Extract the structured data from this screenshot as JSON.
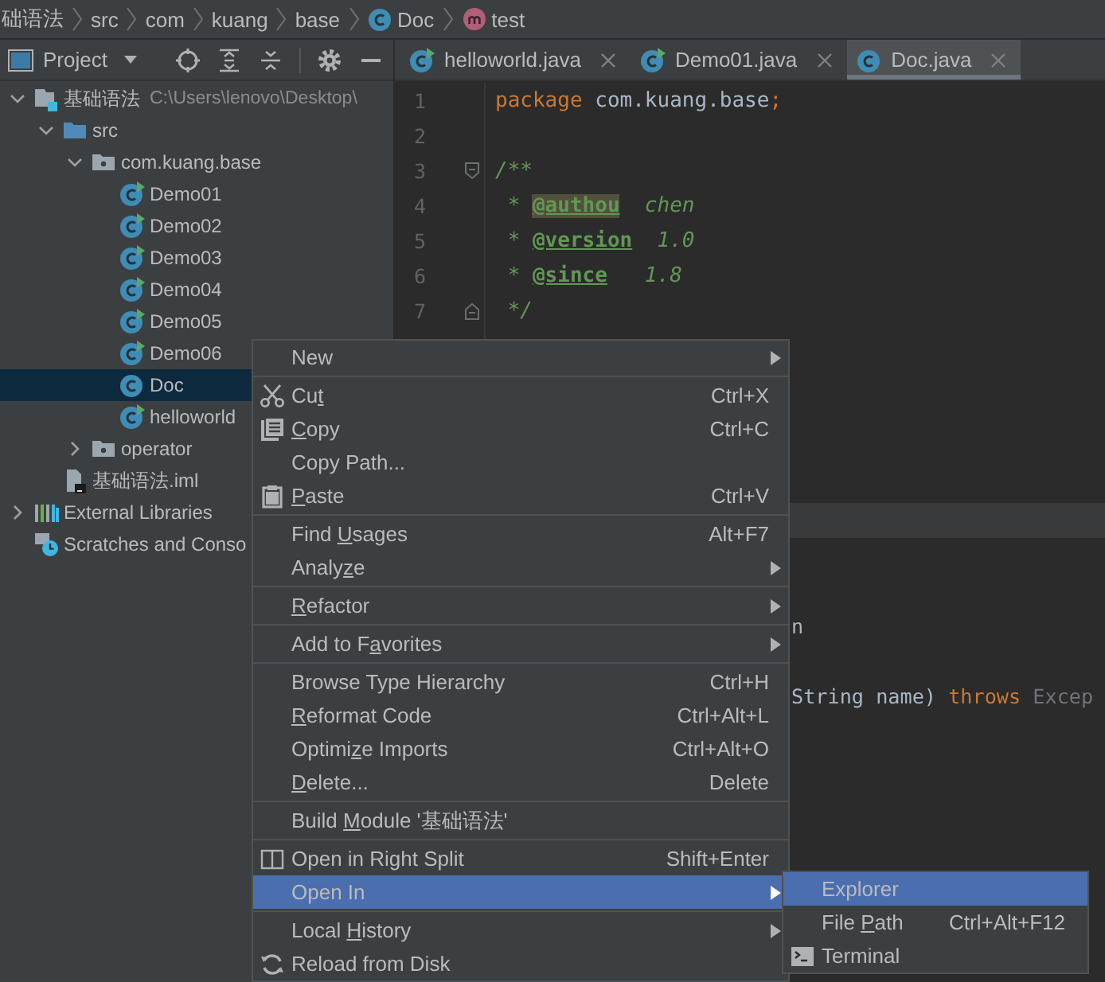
{
  "breadcrumbs": [
    {
      "label": "础语法",
      "kind": "text"
    },
    {
      "label": "src",
      "kind": "text"
    },
    {
      "label": "com",
      "kind": "text"
    },
    {
      "label": "kuang",
      "kind": "text"
    },
    {
      "label": "base",
      "kind": "text"
    },
    {
      "label": "Doc",
      "kind": "class"
    },
    {
      "label": "test",
      "kind": "method"
    }
  ],
  "project_panel": {
    "title": "Project"
  },
  "tree": [
    {
      "label": "基础语法",
      "path": "C:\\Users\\lenovo\\Desktop\\",
      "kind": "module",
      "expanded": true,
      "selected": false,
      "children": [
        {
          "label": "src",
          "kind": "folder",
          "expanded": true,
          "selected": false,
          "children": [
            {
              "label": "com.kuang.base",
              "kind": "package",
              "expanded": true,
              "selected": false,
              "children": [
                {
                  "label": "Demo01",
                  "kind": "class",
                  "runnable": true,
                  "selected": false
                },
                {
                  "label": "Demo02",
                  "kind": "class",
                  "runnable": true,
                  "selected": false
                },
                {
                  "label": "Demo03",
                  "kind": "class",
                  "runnable": true,
                  "selected": false
                },
                {
                  "label": "Demo04",
                  "kind": "class",
                  "runnable": true,
                  "selected": false
                },
                {
                  "label": "Demo05",
                  "kind": "class",
                  "runnable": true,
                  "selected": false
                },
                {
                  "label": "Demo06",
                  "kind": "class",
                  "runnable": true,
                  "selected": false
                },
                {
                  "label": "Doc",
                  "kind": "class",
                  "runnable": false,
                  "selected": true
                },
                {
                  "label": "helloworld",
                  "kind": "class",
                  "runnable": true,
                  "selected": false
                }
              ]
            },
            {
              "label": "operator",
              "kind": "package",
              "expanded": false,
              "selected": false
            }
          ]
        },
        {
          "label": "基础语法.iml",
          "kind": "iml",
          "selected": false
        }
      ]
    },
    {
      "label": "External Libraries",
      "kind": "libraries",
      "expanded": false,
      "selected": false
    },
    {
      "label": "Scratches and Conso",
      "kind": "scratches",
      "selected": false
    }
  ],
  "tabs": [
    {
      "label": "helloworld.java",
      "kind": "class",
      "runnable": true,
      "selected": false
    },
    {
      "label": "Demo01.java",
      "kind": "class",
      "runnable": true,
      "selected": false
    },
    {
      "label": "Doc.java",
      "kind": "class",
      "runnable": false,
      "selected": true
    }
  ],
  "editor": {
    "lines": [
      {
        "kind": "code",
        "number": "1",
        "current": false,
        "segments": [
          {
            "kind": "keyword",
            "text": "package "
          },
          {
            "kind": "plain",
            "text": "com.kuang.base"
          },
          {
            "kind": "keyword",
            "text": ";"
          }
        ]
      },
      {
        "kind": "code",
        "number": "2",
        "current": false
      },
      {
        "kind": "fold_start",
        "number": "3",
        "current": false,
        "segments": [
          {
            "kind": "comment",
            "text": "/**"
          }
        ]
      },
      {
        "kind": "code",
        "number": "4",
        "current": false,
        "segments": [
          {
            "kind": "comment",
            "text": " * "
          },
          {
            "kind": "doctag",
            "text": "@authou",
            "highlighted": true
          },
          {
            "kind": "comment",
            "text": "  chen"
          }
        ]
      },
      {
        "kind": "code",
        "number": "5",
        "current": false,
        "segments": [
          {
            "kind": "comment",
            "text": " * "
          },
          {
            "kind": "doctag",
            "text": "@version",
            "highlighted": false
          },
          {
            "kind": "comment",
            "text": "  1.0"
          }
        ]
      },
      {
        "kind": "code",
        "number": "6",
        "current": false,
        "segments": [
          {
            "kind": "comment",
            "text": " * "
          },
          {
            "kind": "doctag",
            "text": "@since",
            "highlighted": false
          },
          {
            "kind": "comment",
            "text": "   1.8"
          }
        ]
      },
      {
        "kind": "fold_end",
        "number": "7",
        "current": false,
        "segments": [
          {
            "kind": "comment",
            "text": " */"
          }
        ]
      },
      {
        "kind": "code",
        "current": false
      },
      {
        "kind": "code",
        "current": false
      },
      {
        "kind": "code",
        "current": false
      },
      {
        "kind": "code",
        "current": false
      },
      {
        "kind": "code",
        "current": false
      },
      {
        "kind": "code",
        "current": true
      },
      {
        "kind": "code",
        "current": false
      },
      {
        "kind": "code",
        "current": false
      },
      {
        "kind": "fragment",
        "current": false,
        "segments": [
          {
            "kind": "plain",
            "text": "n"
          }
        ]
      },
      {
        "kind": "code",
        "current": false
      },
      {
        "kind": "fragment",
        "current": false,
        "segments": [
          {
            "kind": "plain",
            "text": "String name) "
          },
          {
            "kind": "keyword",
            "text": "throws"
          },
          {
            "kind": "unused",
            "text": " Excep"
          }
        ]
      }
    ]
  },
  "menu": {
    "items": [
      {
        "kind": "item",
        "label": [
          {
            "text": "New",
            "underlined": false
          }
        ],
        "has_submenu": true,
        "selected": false
      },
      {
        "kind": "separator"
      },
      {
        "kind": "cut",
        "label": [
          {
            "text": "Cu",
            "underlined": false
          },
          {
            "text": "t",
            "underlined": true
          }
        ],
        "shortcut": "Ctrl+X",
        "has_submenu": false,
        "selected": false
      },
      {
        "kind": "copy",
        "label": [
          {
            "text": "C",
            "underlined": true
          },
          {
            "text": "opy",
            "underlined": false
          }
        ],
        "shortcut": "Ctrl+C",
        "has_submenu": false,
        "selected": false
      },
      {
        "kind": "item",
        "label": [
          {
            "text": "Copy Path...",
            "underlined": false
          }
        ],
        "has_submenu": false,
        "selected": false
      },
      {
        "kind": "paste",
        "label": [
          {
            "text": "P",
            "underlined": true
          },
          {
            "text": "aste",
            "underlined": false
          }
        ],
        "shortcut": "Ctrl+V",
        "has_submenu": false,
        "selected": false
      },
      {
        "kind": "separator"
      },
      {
        "kind": "item",
        "label": [
          {
            "text": "Find ",
            "underlined": false
          },
          {
            "text": "U",
            "underlined": true
          },
          {
            "text": "sages",
            "underlined": false
          }
        ],
        "shortcut": "Alt+F7",
        "has_submenu": false,
        "selected": false
      },
      {
        "kind": "item",
        "label": [
          {
            "text": "Analy",
            "underlined": false
          },
          {
            "text": "z",
            "underlined": true
          },
          {
            "text": "e",
            "underlined": false
          }
        ],
        "has_submenu": true,
        "selected": false
      },
      {
        "kind": "separator"
      },
      {
        "kind": "item",
        "label": [
          {
            "text": "R",
            "underlined": true
          },
          {
            "text": "efactor",
            "underlined": false
          }
        ],
        "has_submenu": true,
        "selected": false
      },
      {
        "kind": "separator"
      },
      {
        "kind": "item",
        "label": [
          {
            "text": "Add to F",
            "underlined": false
          },
          {
            "text": "a",
            "underlined": true
          },
          {
            "text": "vorites",
            "underlined": false
          }
        ],
        "has_submenu": true,
        "selected": false
      },
      {
        "kind": "separator"
      },
      {
        "kind": "item",
        "label": [
          {
            "text": "Browse Type Hierarchy",
            "underlined": false
          }
        ],
        "shortcut": "Ctrl+H",
        "has_submenu": false,
        "selected": false
      },
      {
        "kind": "item",
        "label": [
          {
            "text": "R",
            "underlined": true
          },
          {
            "text": "eformat Code",
            "underlined": false
          }
        ],
        "shortcut": "Ctrl+Alt+L",
        "has_submenu": false,
        "selected": false
      },
      {
        "kind": "item",
        "label": [
          {
            "text": "Optimi",
            "underlined": false
          },
          {
            "text": "z",
            "underlined": true
          },
          {
            "text": "e Imports",
            "underlined": false
          }
        ],
        "shortcut": "Ctrl+Alt+O",
        "has_submenu": false,
        "selected": false
      },
      {
        "kind": "item",
        "label": [
          {
            "text": "D",
            "underlined": true
          },
          {
            "text": "elete...",
            "underlined": false
          }
        ],
        "shortcut": "Delete",
        "has_submenu": false,
        "selected": false
      },
      {
        "kind": "separator"
      },
      {
        "kind": "item",
        "label": [
          {
            "text": "Build ",
            "underlined": false
          },
          {
            "text": "M",
            "underlined": true
          },
          {
            "text": "odule '基础语法'",
            "underlined": false
          }
        ],
        "has_submenu": false,
        "selected": false
      },
      {
        "kind": "separator"
      },
      {
        "kind": "split",
        "label": [
          {
            "text": "Open in Right Split",
            "underlined": false
          }
        ],
        "shortcut": "Shift+Enter",
        "has_submenu": false,
        "selected": false
      },
      {
        "kind": "item",
        "label": [
          {
            "text": "Open In",
            "underlined": false
          }
        ],
        "has_submenu": true,
        "selected": true,
        "submenu": [
          {
            "kind": "item",
            "label": [
              {
                "text": "Explorer",
                "underlined": false
              }
            ],
            "selected": true
          },
          {
            "kind": "item",
            "label": [
              {
                "text": "File ",
                "underlined": false
              },
              {
                "text": "P",
                "underlined": true
              },
              {
                "text": "ath",
                "underlined": false
              }
            ],
            "shortcut": "Ctrl+Alt+F12",
            "selected": false
          },
          {
            "kind": "terminal",
            "label": [
              {
                "text": "Terminal",
                "underlined": false
              }
            ],
            "selected": false
          }
        ]
      },
      {
        "kind": "separator"
      },
      {
        "kind": "item",
        "label": [
          {
            "text": "Local ",
            "underlined": false
          },
          {
            "text": "H",
            "underlined": true
          },
          {
            "text": "istory",
            "underlined": false
          }
        ],
        "has_submenu": true,
        "selected": false
      },
      {
        "kind": "reload",
        "label": [
          {
            "text": "Reload from Disk",
            "underlined": false
          }
        ],
        "has_submenu": false,
        "selected": false
      }
    ]
  }
}
